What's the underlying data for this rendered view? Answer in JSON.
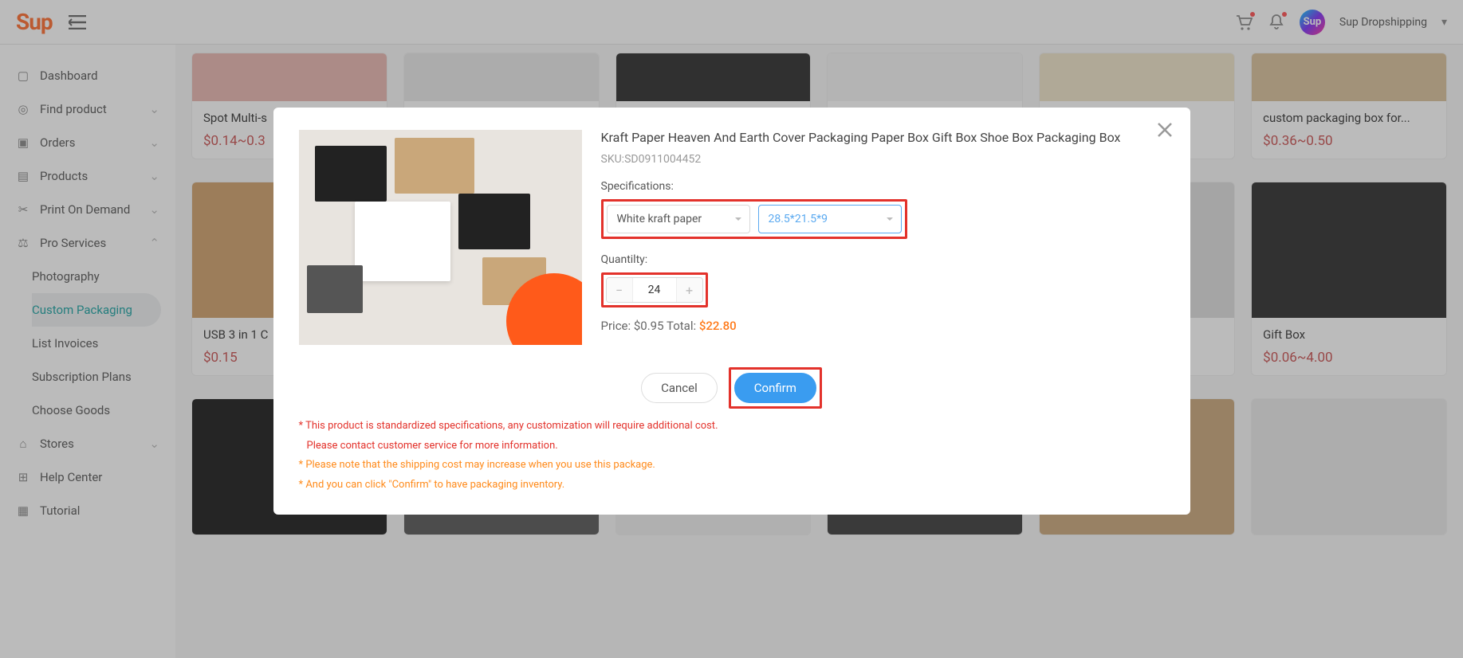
{
  "header": {
    "logo": "Sup",
    "user": "Sup Dropshipping",
    "avatar": "Sup"
  },
  "sidebar": {
    "dashboard": "Dashboard",
    "find_product": "Find product",
    "orders": "Orders",
    "products": "Products",
    "print_on_demand": "Print On Demand",
    "pro_services": "Pro Services",
    "photography": "Photography",
    "custom_packaging": "Custom Packaging",
    "list_invoices": "List Invoices",
    "subscription_plans": "Subscription Plans",
    "choose_goods": "Choose Goods",
    "stores": "Stores",
    "help_center": "Help Center",
    "tutorial": "Tutorial"
  },
  "products_row1": [
    {
      "title": "Spot Multi-s",
      "price": "$0.14~0.3"
    },
    {
      "title": "",
      "price": ""
    },
    {
      "title": "",
      "price": ""
    },
    {
      "title": "",
      "price": ""
    },
    {
      "title": "",
      "price": ""
    },
    {
      "title": "custom packaging box for...",
      "price": "$0.36~0.50"
    }
  ],
  "products_row2": [
    {
      "title": "USB 3 in 1 C",
      "price": "$0.15"
    },
    {
      "title": "",
      "price": ""
    },
    {
      "title": "",
      "price": ""
    },
    {
      "title": "",
      "price": ""
    },
    {
      "title": "",
      "price": ""
    },
    {
      "title": "Gift Box",
      "price": "$0.06~4.00"
    }
  ],
  "modal": {
    "title": "Kraft Paper Heaven And Earth Cover Packaging Paper Box Gift Box Shoe Box Packaging Box",
    "sku_label": "SKU:",
    "sku": "SD0911004452",
    "spec_label": "Specifications:",
    "spec1": "White kraft paper",
    "spec2": "28.5*21.5*9",
    "qty_label": "Quantilty:",
    "qty": "24",
    "price_label": "Price: ",
    "price": "$0.95",
    "total_label": " Total: ",
    "total": "$22.80",
    "cancel": "Cancel",
    "confirm": "Confirm",
    "note1a": "* This product is standardized specifications, any customization will require additional cost.",
    "note1b": "Please contact customer service for more information.",
    "note2": "* Please note that the shipping cost may increase when you use this package.",
    "note3": "* And you can click \"Confirm\" to have packaging inventory."
  }
}
